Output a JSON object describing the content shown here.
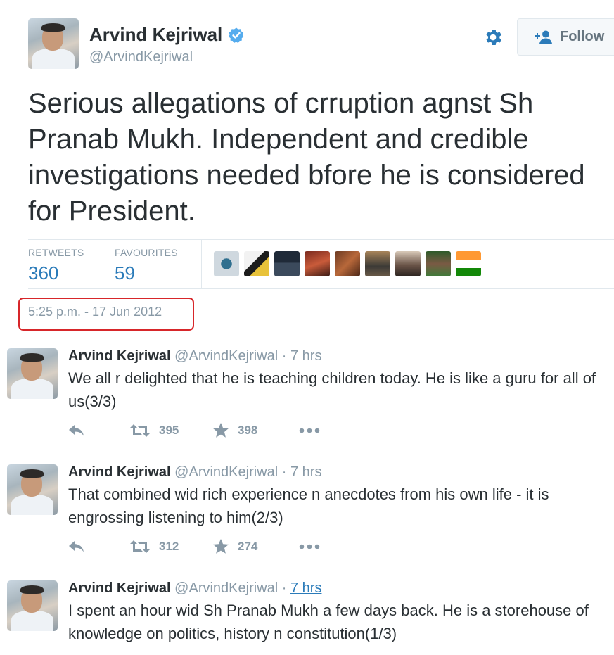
{
  "author": {
    "name": "Arvind Kejriwal",
    "handle": "@ArvindKejriwal",
    "verified": true,
    "verified_icon": "verified-badge-icon"
  },
  "header_actions": {
    "settings_icon": "gear-icon",
    "follow_label": "Follow",
    "follow_icon": "add-user-icon"
  },
  "tweet": {
    "text": "Serious allegations of crruption agnst Sh Pranab Mukh. Independent and credible investigations needed bfore he is considered for President.",
    "timestamp": "5:25 p.m. - 17 Jun 2012"
  },
  "stats": {
    "retweets_label": "RETWEETS",
    "retweets": "360",
    "favourites_label": "FAVOURITES",
    "favourites": "59"
  },
  "colors": {
    "link": "#2b7bb9",
    "highlight_box": "#d7262a",
    "muted": "#8899a6",
    "text": "#292f33"
  },
  "replies": [
    {
      "name": "Arvind Kejriwal",
      "handle": "@ArvindKejriwal",
      "separator": "·",
      "time": "7 hrs",
      "text": "We all r delighted that he is teaching children today. He is like a guru for all of us(3/3)",
      "retweets": "395",
      "favourites": "398"
    },
    {
      "name": "Arvind Kejriwal",
      "handle": "@ArvindKejriwal",
      "separator": "·",
      "time": "7 hrs",
      "text": "That combined wid rich experience n anecdotes from his own life - it is engrossing listening to him(2/3)",
      "retweets": "312",
      "favourites": "274"
    },
    {
      "name": "Arvind Kejriwal",
      "handle": "@ArvindKejriwal",
      "separator": "·",
      "time": "7 hrs",
      "text": "I spent an hour wid Sh Pranab Mukh a few days back. He is a storehouse of knowledge on politics, history n constitution(1/3)"
    }
  ]
}
